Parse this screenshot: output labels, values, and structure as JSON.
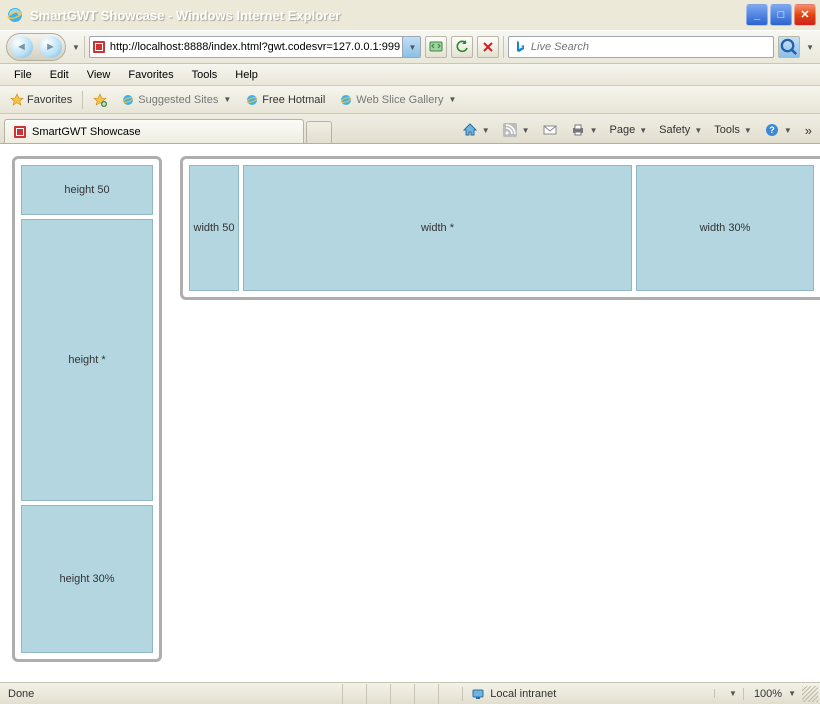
{
  "window": {
    "title": "SmartGWT Showcase - Windows Internet Explorer"
  },
  "address": {
    "url": "http://localhost:8888/index.html?gwt.codesvr=127.0.0.1:999"
  },
  "search": {
    "placeholder": "Live Search"
  },
  "menu": {
    "file": "File",
    "edit": "Edit",
    "view": "View",
    "favorites": "Favorites",
    "tools": "Tools",
    "help": "Help"
  },
  "linksbar": {
    "favorites": "Favorites",
    "suggested": "Suggested Sites",
    "hotmail": "Free Hotmail",
    "webslice": "Web Slice Gallery"
  },
  "tab": {
    "title": "SmartGWT Showcase"
  },
  "cmdbar": {
    "page": "Page",
    "safety": "Safety",
    "tools": "Tools"
  },
  "layout": {
    "v1": "height 50",
    "v2": "height *",
    "v3": "height 30%",
    "h1": "width 50",
    "h2": "width *",
    "h3": "width 30%"
  },
  "status": {
    "done": "Done",
    "zone": "Local intranet",
    "zoom": "100%"
  }
}
